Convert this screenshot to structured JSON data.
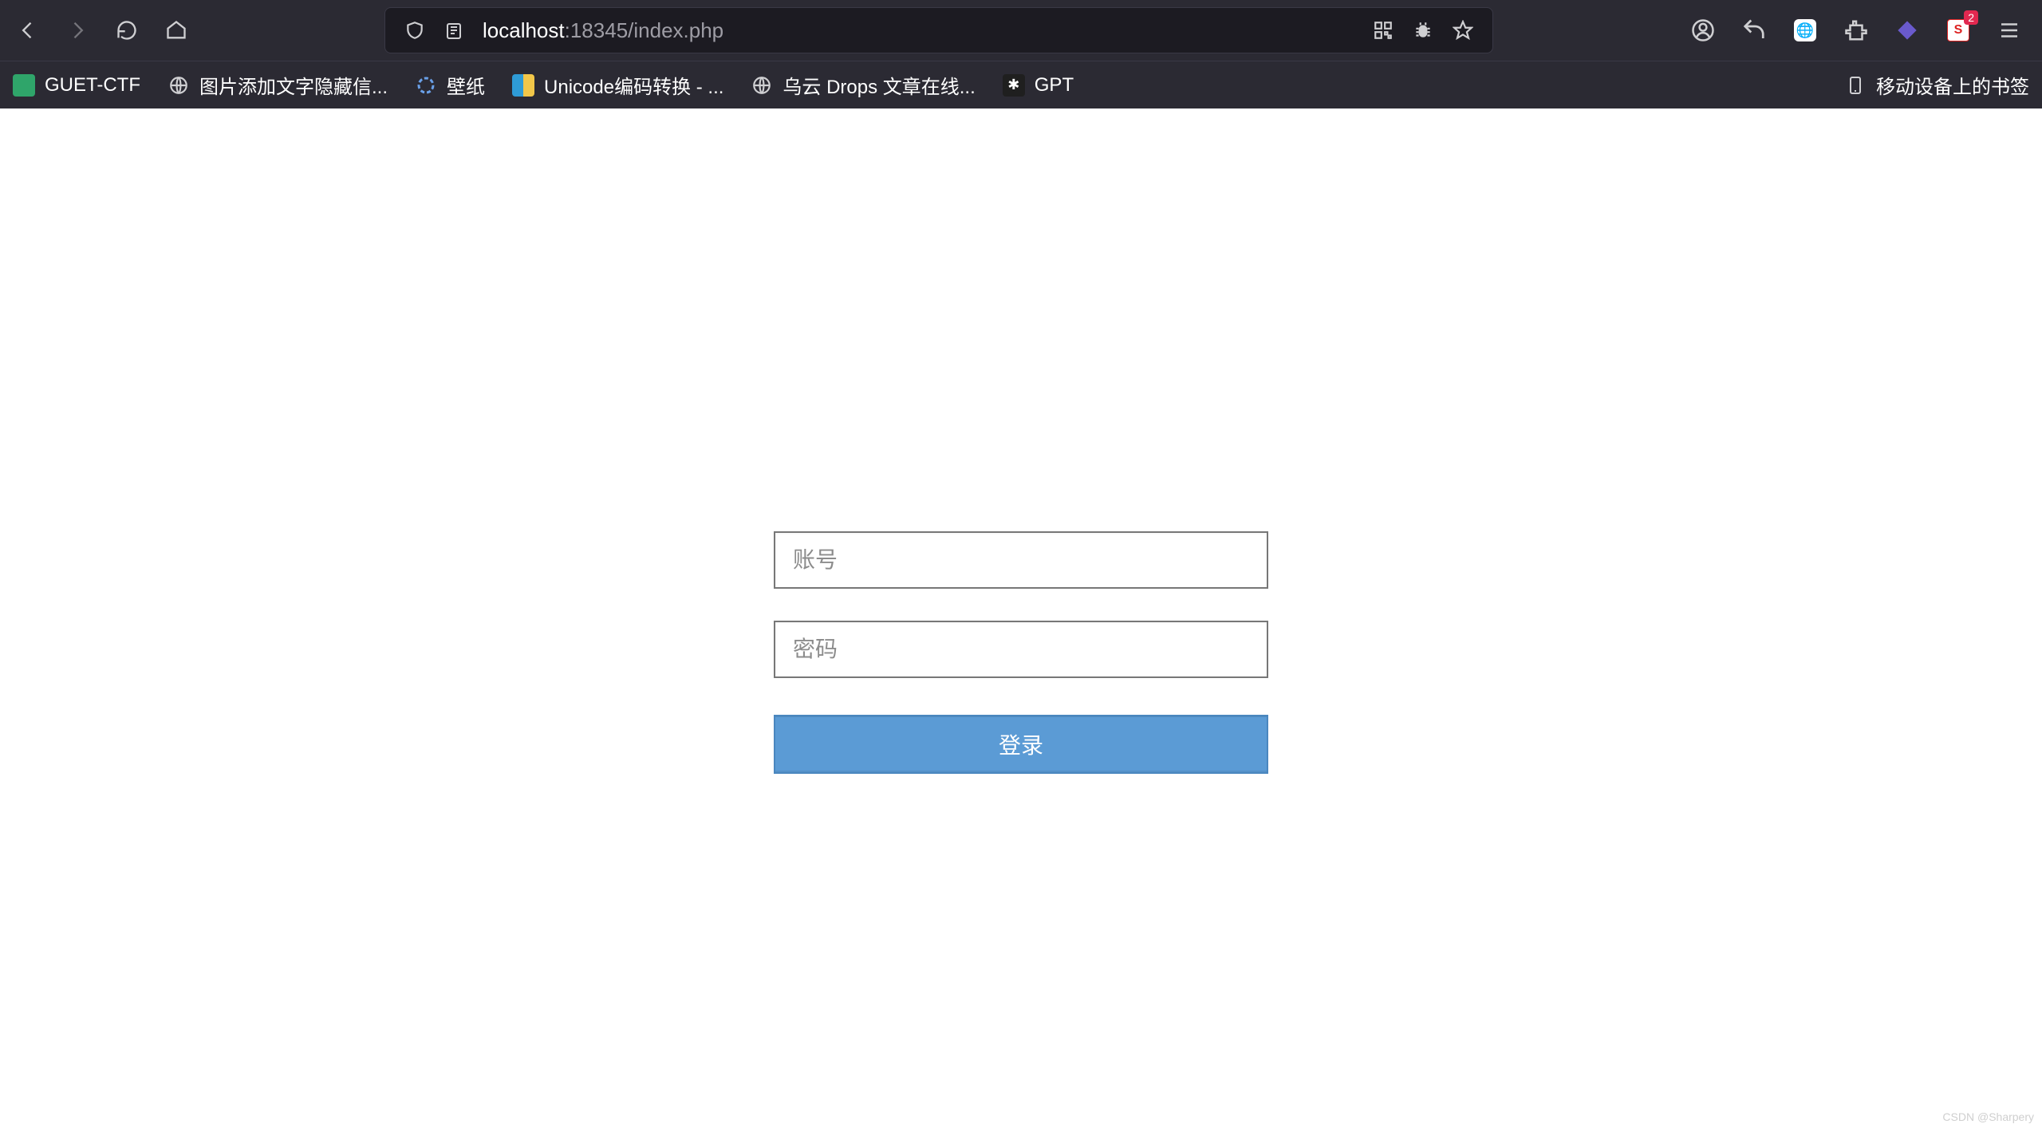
{
  "toolbar": {
    "url_host": "localhost",
    "url_rest": ":18345/index.php"
  },
  "bookmarks": {
    "items": [
      {
        "label": "GUET-CTF",
        "favcolor": "#2fa56a"
      },
      {
        "label": "图片添加文字隐藏信...",
        "favcolor": "#9e9e9e"
      },
      {
        "label": "壁纸",
        "favcolor": "#6aa0e8"
      },
      {
        "label": "Unicode编码转换 - ...",
        "favcolor": "#f2c749"
      },
      {
        "label": "乌云 Drops 文章在线...",
        "favcolor": "#9e9e9e"
      },
      {
        "label": "GPT",
        "favcolor": "#1f1f1f"
      }
    ],
    "mobile_label": "移动设备上的书签"
  },
  "form": {
    "username_placeholder": "账号",
    "password_placeholder": "密码",
    "submit_label": "登录"
  },
  "ext_badge": "2",
  "watermark": "CSDN @Sharpery"
}
